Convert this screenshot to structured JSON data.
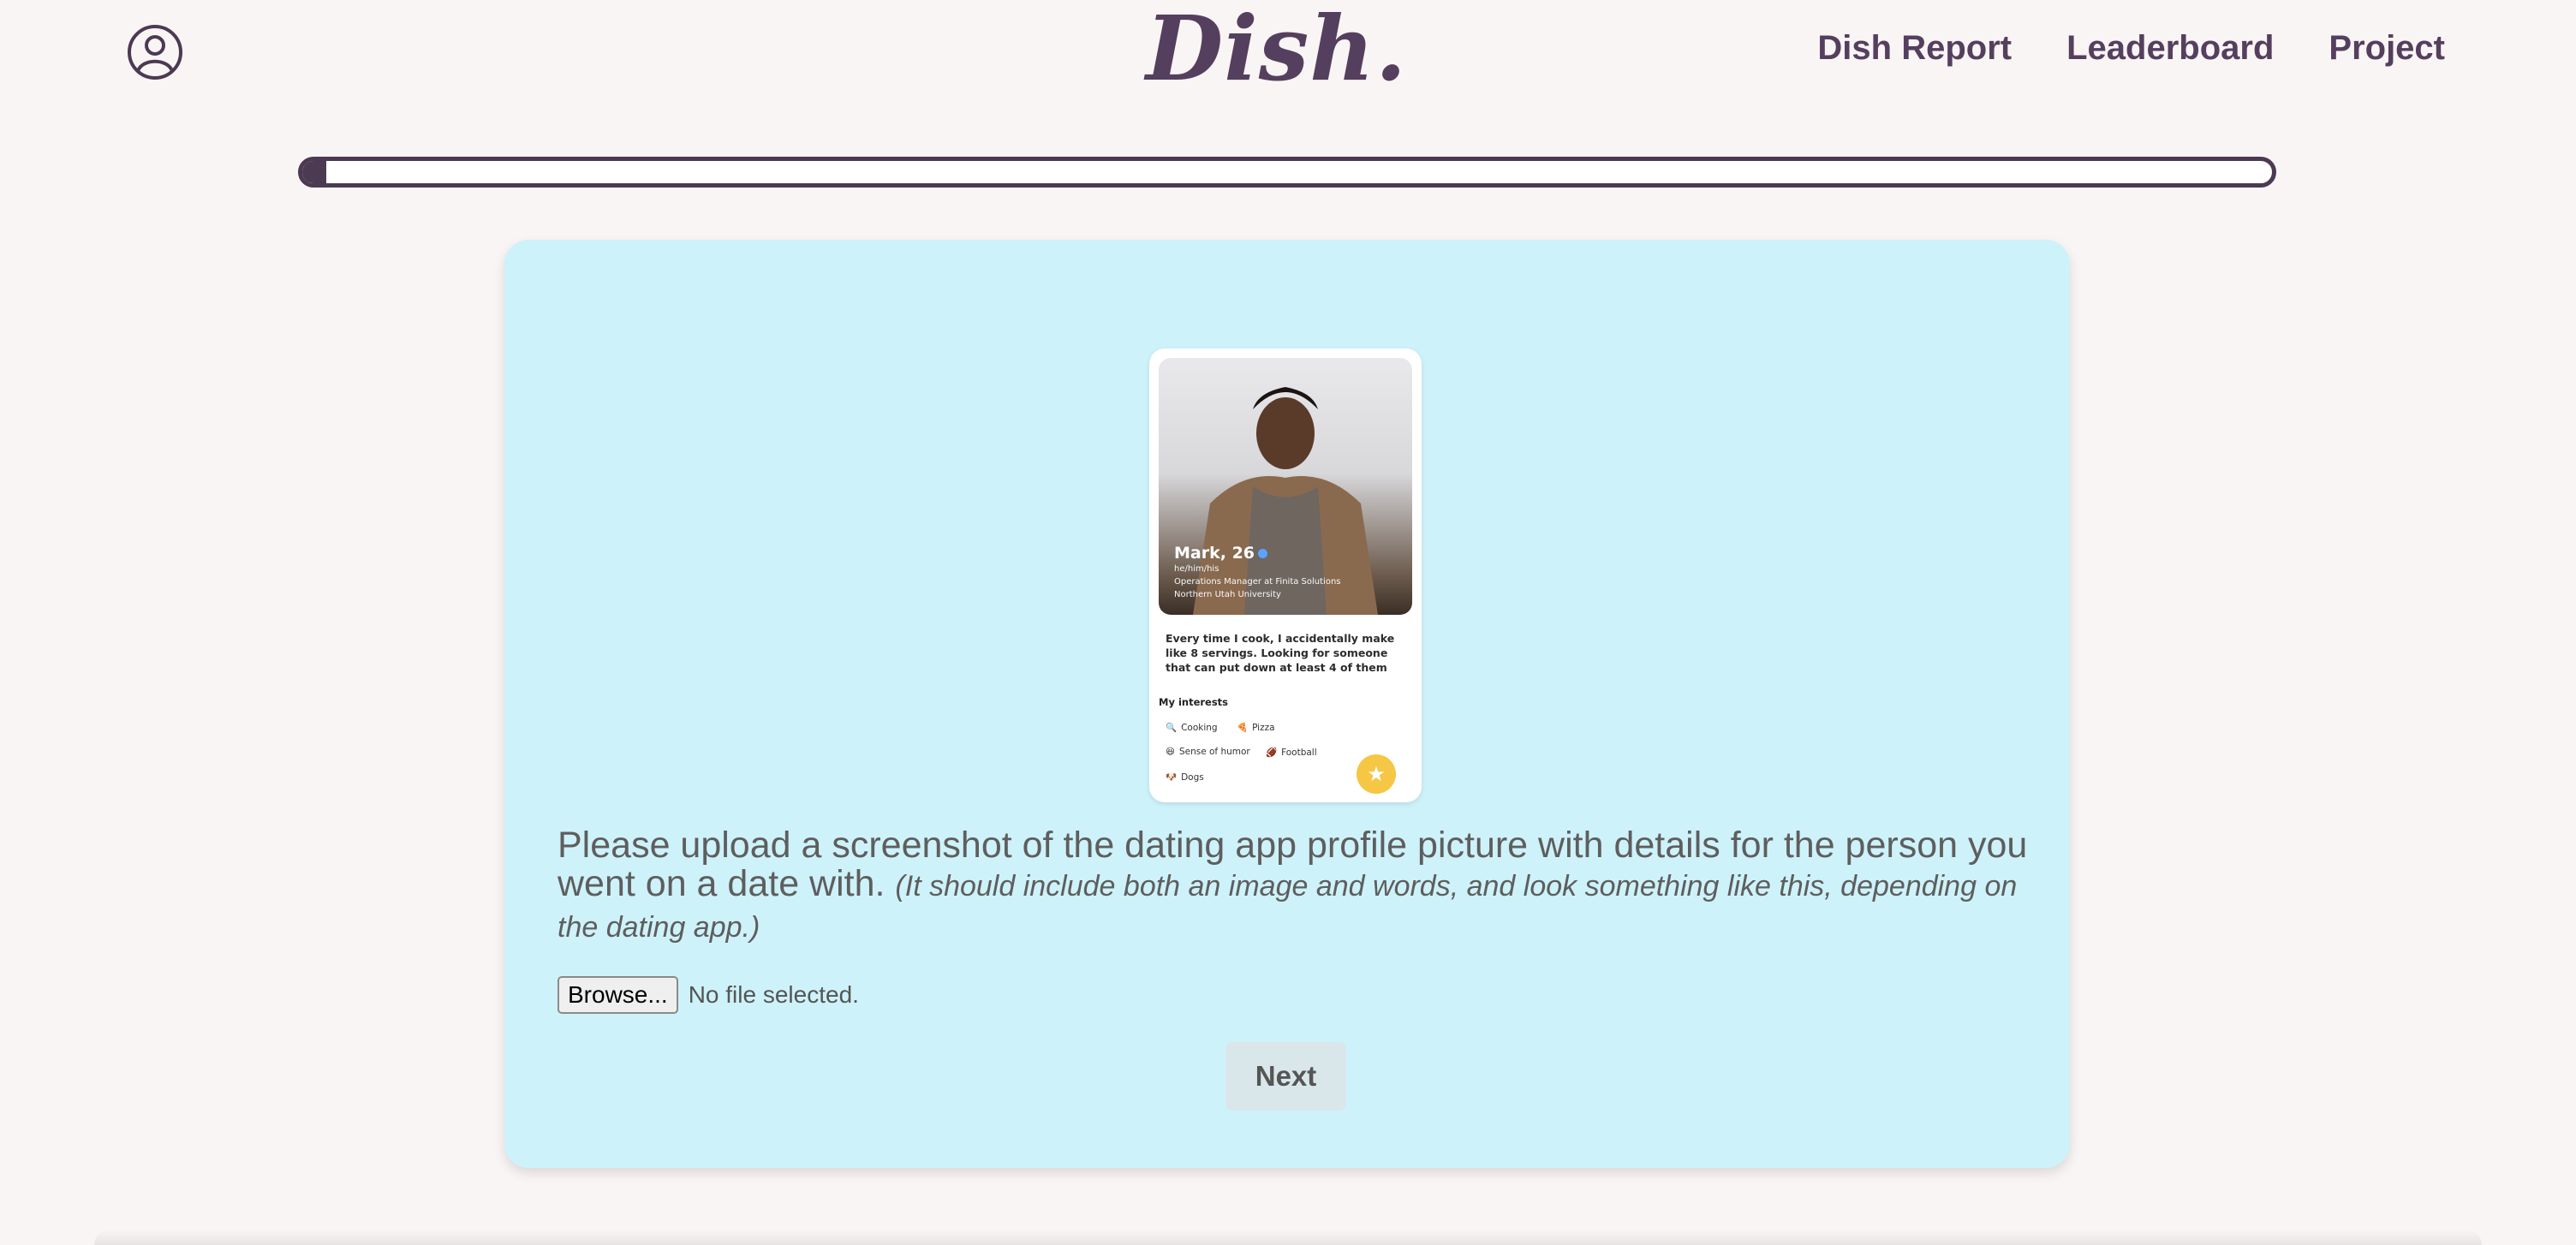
{
  "header": {
    "logo": "Dish.",
    "profile_icon": "user-circle-icon",
    "nav": [
      "Dish Report",
      "Leaderboard",
      "Project"
    ]
  },
  "progress": {
    "value": 0.012
  },
  "upload": {
    "example": {
      "name": "Mark, 26",
      "pronouns": "he/him/his",
      "job": "Operations Manager at Finita Solutions",
      "school": "Northern Utah University",
      "bio": "Every time I cook, I accidentally make like 8 servings. Looking for someone that can put down at least 4 of them",
      "interests_title": "My interests",
      "interests": [
        "Cooking",
        "Pizza",
        "Sense of humor",
        "Football",
        "Dogs"
      ]
    },
    "instruction": "Please upload a screenshot of the dating app profile picture with details for the person you went on a date with.",
    "note": "(It should include both an image and words, and look something like this, depending on the dating app.)",
    "browse_label": "Browse...",
    "file_status": "No file selected.",
    "next_label": "Next"
  },
  "colors": {
    "brand": "#553f5e",
    "card_bg": "#cef2fa",
    "page_bg": "#faf5f5",
    "next_bg": "#d9e7ea"
  }
}
